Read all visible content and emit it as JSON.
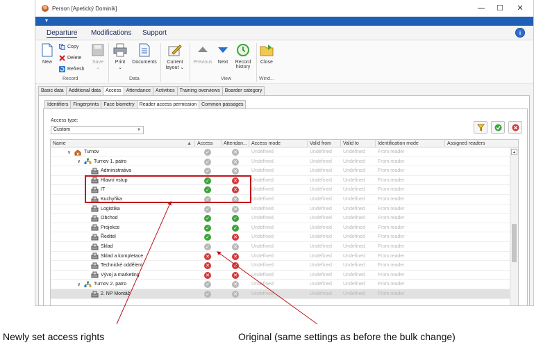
{
  "window": {
    "title": "Person [Apetický Dominik]",
    "controls": {
      "minimize": "—",
      "maximize": "☐",
      "close": "✕"
    }
  },
  "quick_access": "▾",
  "menu": {
    "items": [
      "Departure",
      "Modifications",
      "Support"
    ],
    "info": "i"
  },
  "ribbon": {
    "new": "New",
    "copy": "Copy",
    "delete": "Delete",
    "refresh": "Refresh",
    "save": "Save",
    "print": "Print",
    "documents": "Documents",
    "current_layout_1": "Current",
    "current_layout_2": "layout",
    "previous": "Previous",
    "next": "Next",
    "record_history_1": "Record",
    "record_history_2": "history",
    "close": "Close",
    "groups": [
      "Record",
      "Data",
      "View",
      "Wind..."
    ]
  },
  "tabs": [
    "Basic data",
    "Additional data",
    "Access",
    "Attendance",
    "Activities",
    "Training overviews",
    "Boarder category"
  ],
  "subtabs": [
    "Identifiers",
    "Fingerprints",
    "Face biometry",
    "Reader access permission",
    "Common passages"
  ],
  "access_type": {
    "label": "Access type:",
    "value": "Custom"
  },
  "grid": {
    "columns": [
      "Name",
      "Access",
      "Attendan...",
      "Access mode",
      "Valid from",
      "Valid to",
      "Identification mode",
      "Assigned readers"
    ],
    "undefined": "Undefined",
    "from_reader": "From reader",
    "rows": [
      {
        "name": "Turnov",
        "level": 1,
        "type": "site",
        "expand": "∨",
        "access": "neutral",
        "attendance": "neutral-x"
      },
      {
        "name": "Turnov 1. patro",
        "level": 2,
        "type": "group",
        "expand": "∨",
        "access": "neutral",
        "attendance": "neutral-x"
      },
      {
        "name": "Administrativa",
        "level": 3,
        "type": "reader",
        "access": "neutral",
        "attendance": "neutral-x"
      },
      {
        "name": "Hlavní vstup",
        "level": 3,
        "type": "reader",
        "access": "ok",
        "attendance": "no"
      },
      {
        "name": "IT",
        "level": 3,
        "type": "reader",
        "access": "ok",
        "attendance": "no"
      },
      {
        "name": "Kuchyňka",
        "level": 3,
        "type": "reader",
        "access": "neutral",
        "attendance": "neutral-x"
      },
      {
        "name": "Logistika",
        "level": 3,
        "type": "reader",
        "access": "neutral",
        "attendance": "neutral-x"
      },
      {
        "name": "Obchod",
        "level": 3,
        "type": "reader",
        "access": "ok",
        "attendance": "ok"
      },
      {
        "name": "Projekce",
        "level": 3,
        "type": "reader",
        "access": "ok",
        "attendance": "ok"
      },
      {
        "name": "Ředitel",
        "level": 3,
        "type": "reader",
        "access": "ok",
        "attendance": "no"
      },
      {
        "name": "Sklad",
        "level": 3,
        "type": "reader",
        "access": "neutral",
        "attendance": "neutral-x"
      },
      {
        "name": "Sklad a kompletace",
        "level": 3,
        "type": "reader",
        "access": "no",
        "attendance": "no"
      },
      {
        "name": "Technické oddělení",
        "level": 3,
        "type": "reader",
        "access": "no",
        "attendance": "no"
      },
      {
        "name": "Vývoj a marketing",
        "level": 3,
        "type": "reader",
        "access": "no",
        "attendance": "no"
      },
      {
        "name": "Turnov 2. patro",
        "level": 2,
        "type": "group",
        "expand": "∨",
        "access": "neutral",
        "attendance": "neutral-x"
      },
      {
        "name": "2. NP Montáž",
        "level": 3,
        "type": "reader",
        "access": "neutral",
        "attendance": "neutral-x",
        "selected": true
      }
    ]
  },
  "annotations": {
    "left": "Newly set access rights",
    "right": "Original (same settings as before the bulk change)"
  },
  "colors": {
    "accent_blue": "#1f5fb5",
    "ok_green": "#3aa53a",
    "no_red": "#d23a3a",
    "neutral_gray": "#b8b8b8",
    "highlight_red": "#c0141c"
  }
}
